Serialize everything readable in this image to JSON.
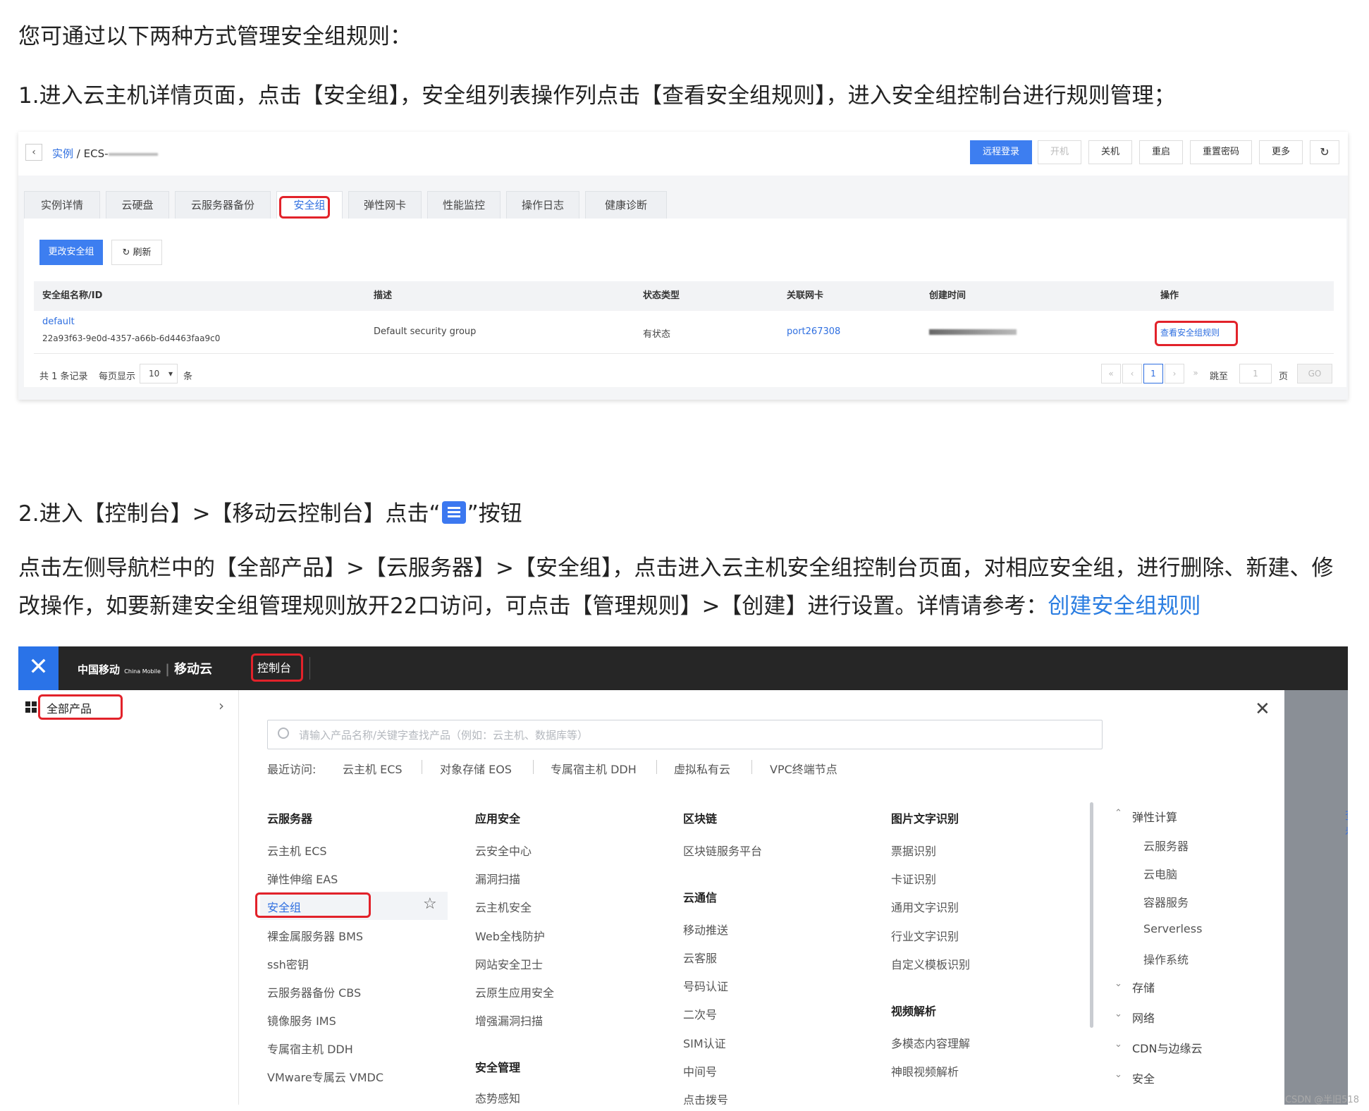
{
  "intro": "您可通过以下两种方式管理安全组规则：",
  "step1": "1.进入云主机详情页面，点击【安全组】，安全组列表操作列点击【查看安全组规则】，进入安全组控制台进行规则管理；",
  "step2_before": "2.进入【控制台】>【移动云控制台】点击“",
  "step2_after": "”按钮",
  "step2_icon": "menu-icon",
  "para3": "点击左侧导航栏中的【全部产品】>【云服务器】>【安全组】，点击进入云主机安全组控制台页面，对相应安全组，进行删除、新建、修改操作，如要新建安全组管理规则放开22口访问，可点击【管理规则】>【创建】进行设置。详情请参考：",
  "para3_link": "创建安全组规则",
  "shot1": {
    "crumb_link": "实例",
    "crumb_sep": "/",
    "crumb_ecs": "ECS-",
    "buttons": [
      "远程登录",
      "开机",
      "关机",
      "重启",
      "重置密码",
      "更多"
    ],
    "tabs": [
      "实例详情",
      "云硬盘",
      "云服务器备份",
      "安全组",
      "弹性网卡",
      "性能监控",
      "操作日志",
      "健康诊断"
    ],
    "btn_change": "更改安全组",
    "btn_refresh": "刷新",
    "columns": [
      "安全组名称/ID",
      "描述",
      "状态类型",
      "关联网卡",
      "创建时间",
      "操作"
    ],
    "row": {
      "name": "default",
      "id": "22a93f63-9e0d-4357-a66b-6d4463faa9c0",
      "desc": "Default security group",
      "status": "有状态",
      "nic": "port267308",
      "action": "查看安全组规则"
    },
    "total": "共 1 条记录",
    "per_page_label": "每页显示",
    "per_page": "10",
    "per_page_unit": "条",
    "current_page": "1",
    "jump_label": "跳至",
    "jump_value": "1",
    "page_unit": "页",
    "go": "GO"
  },
  "shot2": {
    "logo_cn": "中国移动",
    "logo_en": "China Mobile",
    "logo_cloud": "移动云",
    "console": "控制台",
    "all_products": "全部产品",
    "search_placeholder": "请输入产品名称/关键字查找产品（例如：云主机、数据库等）",
    "recent_label": "最近访问:",
    "recent": [
      "云主机 ECS",
      "对象存储 EOS",
      "专属宿主机 DDH",
      "虚拟私有云",
      "VPC终端节点"
    ],
    "col1": {
      "title": "云服务器",
      "items": [
        "云主机 ECS",
        "弹性伸缩 EAS",
        "安全组",
        "裸金属服务器 BMS",
        "ssh密钥",
        "云服务器备份 CBS",
        "镜像服务 IMS",
        "专属宿主机 DDH",
        "VMware专属云 VMDC"
      ]
    },
    "col2": {
      "title": "应用安全",
      "items": [
        "云安全中心",
        "漏洞扫描",
        "云主机安全",
        "Web全栈防护",
        "网站安全卫士",
        "云原生应用安全",
        "增强漏洞扫描"
      ],
      "title2": "安全管理",
      "items2": [
        "态势感知"
      ]
    },
    "col3": {
      "title": "区块链",
      "items": [
        "区块链服务平台"
      ],
      "title2": "云通信",
      "items2": [
        "移动推送",
        "云客服",
        "号码认证",
        "二次号",
        "SIM认证",
        "中间号",
        "点击拨号"
      ]
    },
    "col4": {
      "title": "图片文字识别",
      "items": [
        "票据识别",
        "卡证识别",
        "通用文字识别",
        "行业文字识别",
        "自定义模板识别"
      ],
      "title2": "视频解析",
      "items2": [
        "多模态内容理解",
        "神眼视频解析"
      ]
    },
    "tree": {
      "group1": "弹性计算",
      "group1_items": [
        "云服务器",
        "云电脑",
        "容器服务",
        "Serverless",
        "操作系统"
      ],
      "others": [
        "存储",
        "网络",
        "CDN与边缘云",
        "安全"
      ]
    },
    "right_peek": "查看"
  },
  "watermark": "CSDN @半旧518"
}
